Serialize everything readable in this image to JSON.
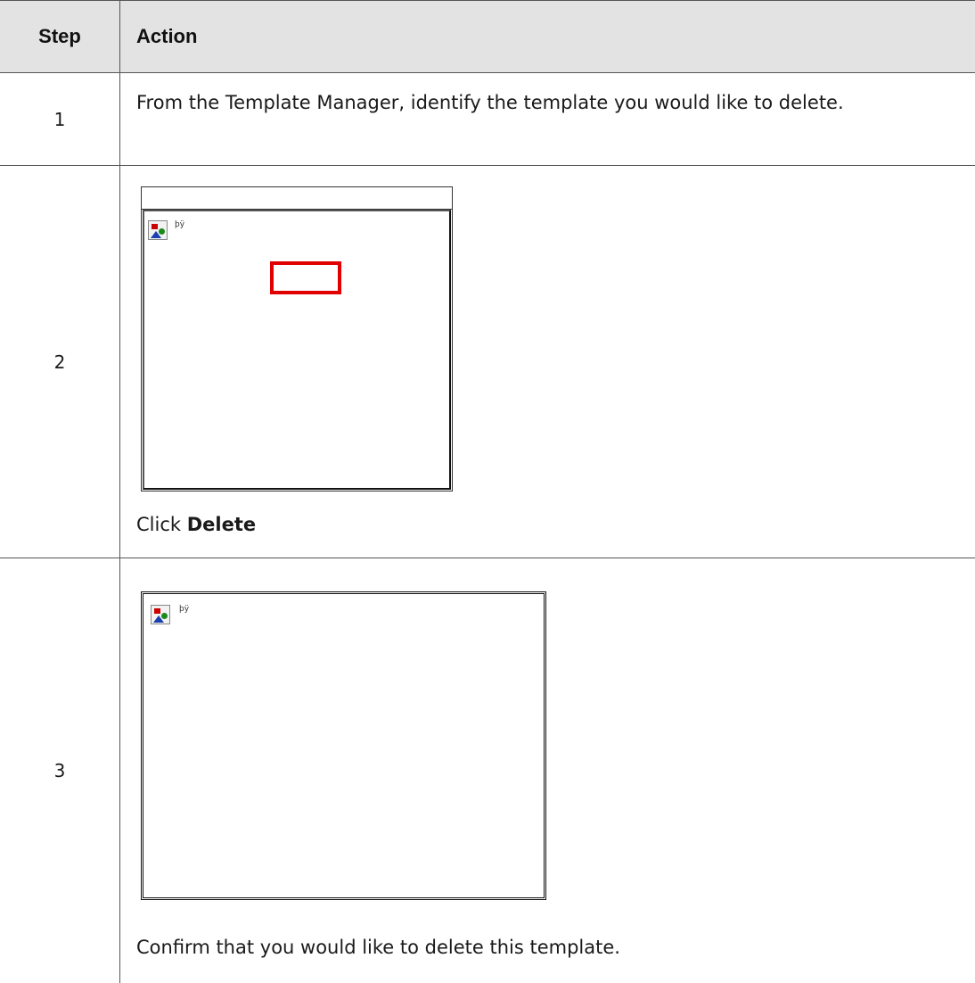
{
  "header": {
    "step_label": "Step",
    "action_label": "Action"
  },
  "steps": [
    {
      "number": "1",
      "text": "From the Template Manager, identify the template you would like to delete."
    },
    {
      "number": "2",
      "screenshot_alt": "þÿ",
      "caption_prefix": "Click ",
      "caption_bold": "Delete"
    },
    {
      "number": "3",
      "screenshot_alt": "þÿ",
      "caption": "Confirm that you would like to delete this template."
    }
  ],
  "colors": {
    "header_bg": "#e3e3e3",
    "highlight": "#e00000"
  },
  "icons": [
    "broken-image-icon"
  ]
}
